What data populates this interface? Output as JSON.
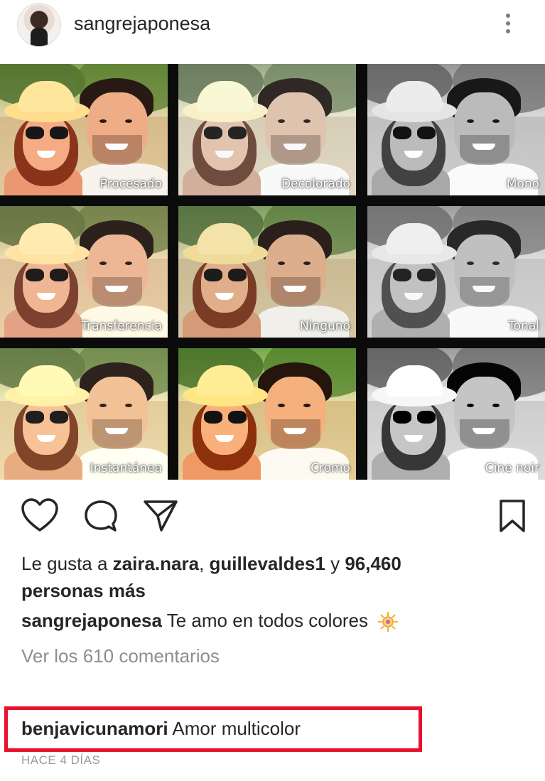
{
  "post": {
    "username": "sangrejaponesa",
    "filters": [
      "Procesado",
      "Decolorado",
      "Mono",
      "Transferencia",
      "Ninguno",
      "Tonal",
      "Instantánea",
      "Cromo",
      "Cine noir"
    ]
  },
  "likes": {
    "prefix": "Le gusta a",
    "user1": "zaira.nara",
    "separator": ",",
    "user2": "guillevaldes1",
    "conjunction": "y",
    "count": "96,460",
    "suffix": "personas más"
  },
  "caption": {
    "username": "sangrejaponesa",
    "text": "Te amo en todos colores"
  },
  "view_comments": "Ver los 610 comentarios",
  "comment": {
    "username": "benjavicunamori",
    "text": "Amor multicolor"
  },
  "timestamp": "HACE 4 DÍAS",
  "colors": {
    "highlight": "#e8112d",
    "text": "#262626",
    "muted": "#8e8e8e"
  },
  "icons": [
    "more-vert-icon",
    "heart-icon",
    "comment-icon",
    "share-icon",
    "bookmark-icon",
    "sun-emoji-icon"
  ]
}
